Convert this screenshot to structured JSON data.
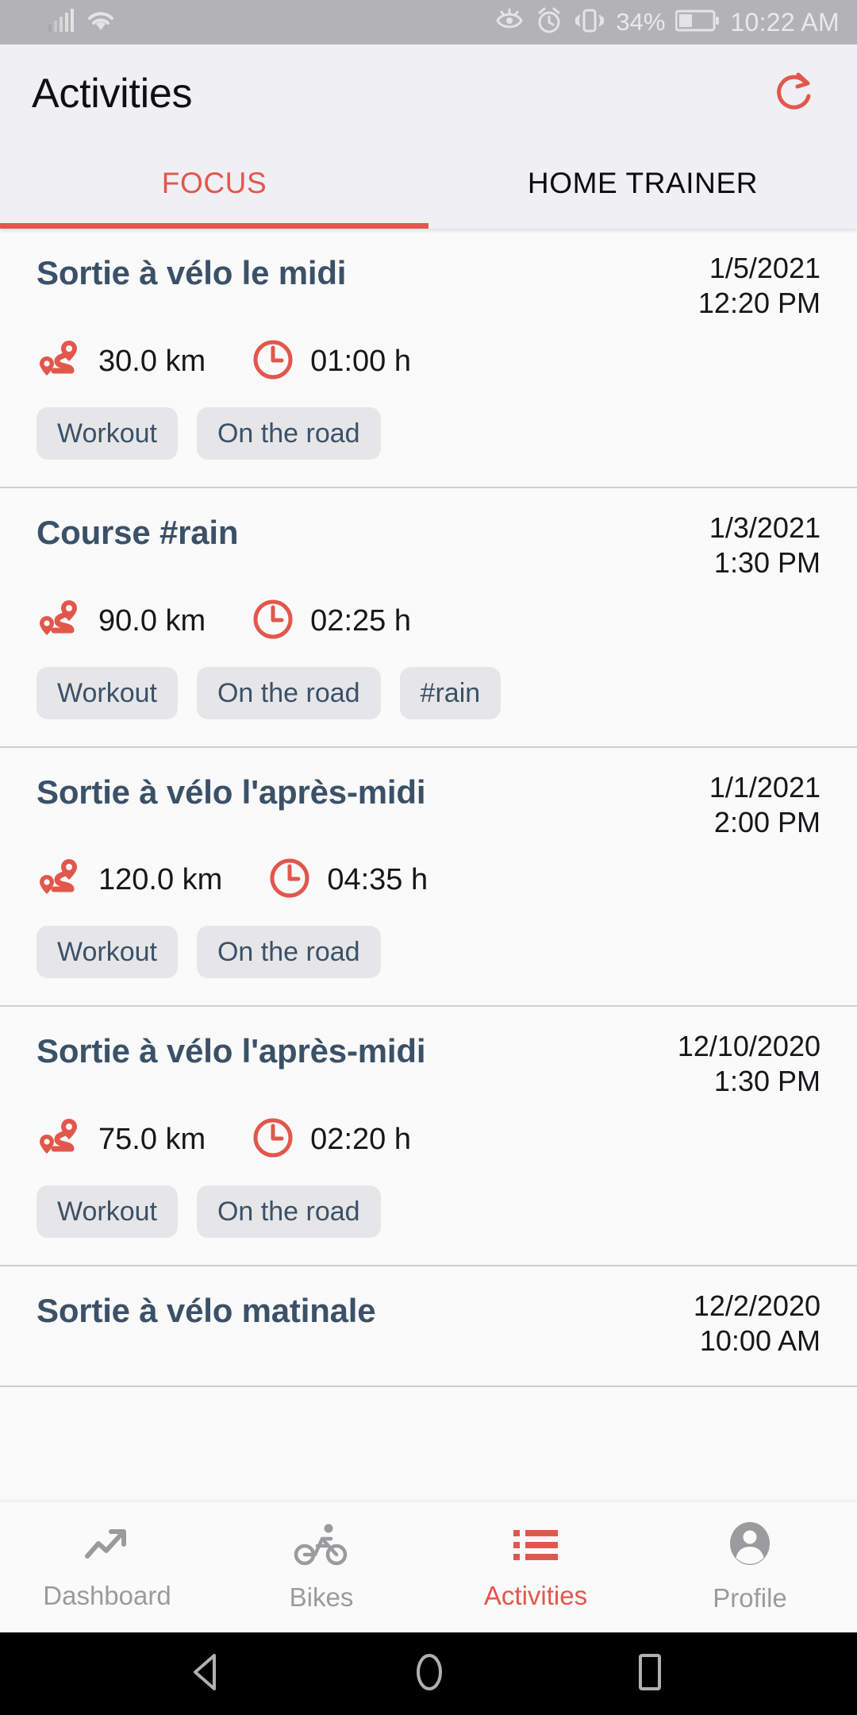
{
  "status_bar": {
    "signal_icon": "cell-signal-icon",
    "wifi_icon": "wifi-icon",
    "eye_icon": "eye-comfort-icon",
    "alarm_icon": "alarm-clock-icon",
    "vibrate_icon": "vibrate-icon",
    "battery_percent": "34%",
    "battery_icon": "battery-icon",
    "clock": "10:22 AM"
  },
  "app_bar": {
    "title": "Activities",
    "refresh_icon": "refresh-icon"
  },
  "tabs": [
    {
      "label": "FOCUS",
      "active": true
    },
    {
      "label": "HOME TRAINER",
      "active": false
    }
  ],
  "icons": {
    "distance": "route-icon",
    "duration": "clock-icon"
  },
  "activities": [
    {
      "title": "Sortie à vélo le midi",
      "date": "1/5/2021",
      "time": "12:20 PM",
      "distance": "30.0 km",
      "duration": "01:00 h",
      "tags": [
        "Workout",
        "On the road"
      ]
    },
    {
      "title": "Course #rain",
      "date": "1/3/2021",
      "time": "1:30 PM",
      "distance": "90.0 km",
      "duration": "02:25 h",
      "tags": [
        "Workout",
        "On the road",
        "#rain"
      ]
    },
    {
      "title": "Sortie à vélo l'après-midi",
      "date": "1/1/2021",
      "time": "2:00 PM",
      "distance": "120.0 km",
      "duration": "04:35 h",
      "tags": [
        "Workout",
        "On the road"
      ]
    },
    {
      "title": "Sortie à vélo l'après-midi",
      "date": "12/10/2020",
      "time": "1:30 PM",
      "distance": "75.0 km",
      "duration": "02:20 h",
      "tags": [
        "Workout",
        "On the road"
      ]
    },
    {
      "title": "Sortie à vélo matinale",
      "date": "12/2/2020",
      "time": "10:00 AM",
      "distance": "",
      "duration": "",
      "tags": []
    }
  ],
  "bottom_nav": [
    {
      "label": "Dashboard",
      "icon": "trending-up-icon",
      "active": false
    },
    {
      "label": "Bikes",
      "icon": "bicycle-icon",
      "active": false
    },
    {
      "label": "Activities",
      "icon": "list-icon",
      "active": true
    },
    {
      "label": "Profile",
      "icon": "person-icon",
      "active": false
    }
  ],
  "system_nav": {
    "back_icon": "back-triangle-icon",
    "home_icon": "home-circle-icon",
    "recents_icon": "recents-square-icon"
  },
  "colors": {
    "accent": "#e2574c",
    "title_text": "#3b5168",
    "chip_bg": "#e6e6e8",
    "appbar_bg": "#f0eff4",
    "page_bg": "#fafafa",
    "statusbar_bg": "#b3b3b6",
    "muted": "#9b9b9e"
  }
}
